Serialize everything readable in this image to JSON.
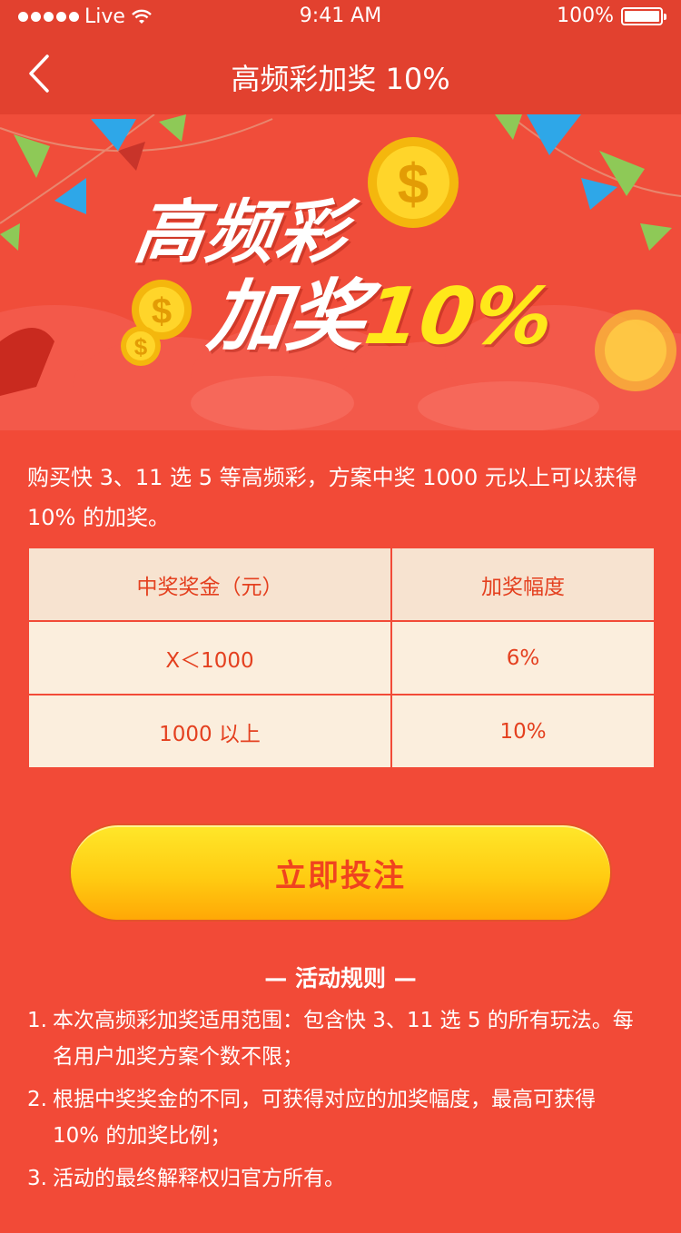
{
  "status_bar": {
    "carrier": "Live",
    "time": "9:41 AM",
    "battery": "100%",
    "battery_level": 1.0
  },
  "nav": {
    "title": "高频彩加奖 10%"
  },
  "banner": {
    "line1": "高频彩",
    "line2_text": "加奖",
    "line2_pct": "10%"
  },
  "intro": {
    "text": "购买快 3、11 选 5 等高频彩，方案中奖 1000 元以上可以获得 10% 的加奖。"
  },
  "table": {
    "headers": [
      "中奖奖金（元）",
      "加奖幅度"
    ],
    "rows": [
      [
        "X＜1000",
        "6%"
      ],
      [
        "1000 以上",
        "10%"
      ]
    ]
  },
  "cta": {
    "label": "立即投注"
  },
  "rules": {
    "heading": "— 活动规则 —",
    "items": [
      {
        "num": "1.",
        "text": "本次高频彩加奖适用范围：包含快 3、11 选 5 的所有玩法。每名用户加奖方案个数不限；"
      },
      {
        "num": "2.",
        "text": "根据中奖奖金的不同，可获得对应的加奖幅度，最高可获得 10% 的加奖比例；"
      },
      {
        "num": "3.",
        "text": "活动的最终解释权归官方所有。"
      }
    ]
  },
  "colors": {
    "background": "#f24a37",
    "nav": "#e2412f",
    "table_header": "#f7e3d0",
    "table_cell": "#fbeedd",
    "table_text": "#e4401f",
    "button_top": "#ffe72a",
    "button_bottom": "#ffa806",
    "highlight_yellow": "#ffe81a"
  }
}
